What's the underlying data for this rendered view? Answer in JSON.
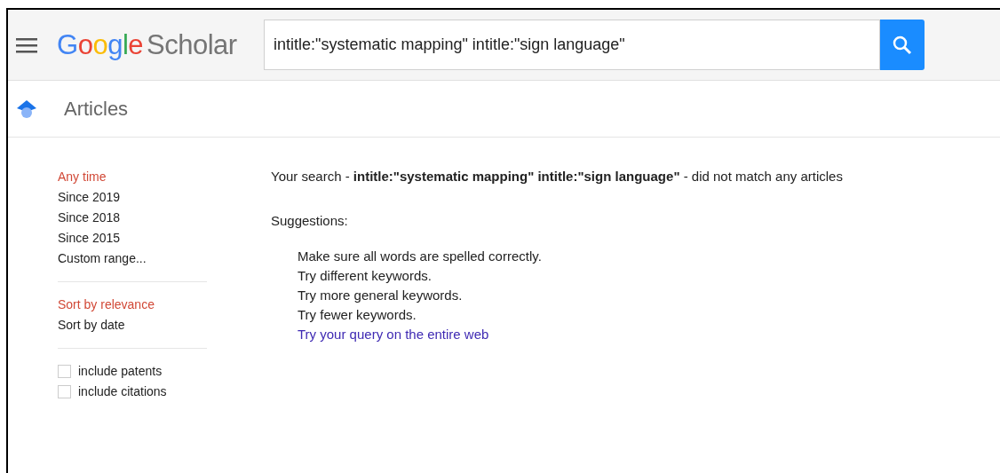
{
  "header": {
    "logo_brand": "Google",
    "logo_product": "Scholar",
    "search": {
      "value": "intitle:\"systematic mapping\" intitle:\"sign language\""
    }
  },
  "section": {
    "title": "Articles"
  },
  "sidebar": {
    "time_filters": [
      {
        "label": "Any time",
        "selected": true
      },
      {
        "label": "Since 2019",
        "selected": false
      },
      {
        "label": "Since 2018",
        "selected": false
      },
      {
        "label": "Since 2015",
        "selected": false
      },
      {
        "label": "Custom range...",
        "selected": false
      }
    ],
    "sort_options": [
      {
        "label": "Sort by relevance",
        "selected": true
      },
      {
        "label": "Sort by date",
        "selected": false
      }
    ],
    "checkboxes": [
      {
        "label": "include patents",
        "checked": false
      },
      {
        "label": "include citations",
        "checked": false
      }
    ]
  },
  "results": {
    "message": "Your search - **intitle:\"systematic mapping\" intitle:\"sign language\"** - did not match any articles",
    "suggestions_title": "Suggestions:",
    "suggestions": [
      {
        "kind": "text",
        "text": "Make sure all words are spelled correctly."
      },
      {
        "kind": "text",
        "text": "Try different keywords."
      },
      {
        "kind": "text",
        "text": "Try more general keywords."
      },
      {
        "kind": "text",
        "text": "Try fewer keywords."
      },
      {
        "kind": "link",
        "text": "Try your query on the entire web"
      }
    ]
  }
}
